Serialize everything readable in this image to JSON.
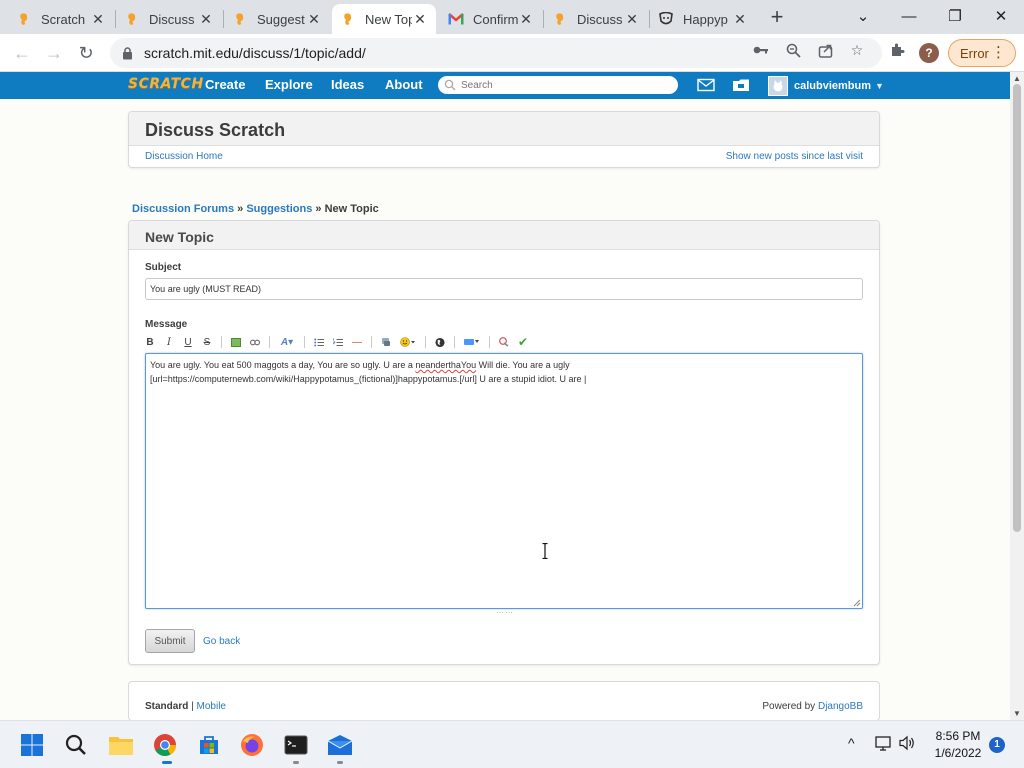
{
  "browser": {
    "tabs": [
      {
        "title": "Scratch",
        "icon": "scratch-favicon",
        "active": false
      },
      {
        "title": "Discuss",
        "icon": "scratch-favicon",
        "active": false
      },
      {
        "title": "Suggest",
        "icon": "scratch-favicon",
        "active": false
      },
      {
        "title": "New Top",
        "icon": "scratch-favicon",
        "active": true
      },
      {
        "title": "Confirm",
        "icon": "gmail-favicon",
        "active": false
      },
      {
        "title": "Discuss",
        "icon": "scratch-favicon",
        "active": false
      },
      {
        "title": "Happyp",
        "icon": "fandom-favicon",
        "active": false
      }
    ],
    "url": "scratch.mit.edu/discuss/1/topic/add/",
    "error_label": "Error",
    "profile_initial": "?",
    "colors": {
      "tabstrip": "#dee1e6",
      "error_bg": "#fde7d1"
    }
  },
  "scratch_nav": {
    "logo_text": "SCRATCH",
    "links": [
      "Create",
      "Explore",
      "Ideas",
      "About"
    ],
    "search_placeholder": "Search",
    "username": "calubviembum",
    "colors": {
      "bar": "#0f7bc0",
      "logo": "#f3b33d"
    }
  },
  "discuss_header": {
    "title": "Discuss Scratch",
    "home_link": "Discussion Home",
    "new_posts_link": "Show new posts since last visit"
  },
  "breadcrumb": {
    "forums": "Discussion Forums",
    "sep": "»",
    "category": "Suggestions",
    "current": "New Topic"
  },
  "new_topic": {
    "heading": "New Topic",
    "subject_label": "Subject",
    "subject_value": "You are ugly (MUST READ)",
    "message_label": "Message",
    "message_part1": "You are ugly. You eat 500 maggots a day, You are so ugly. U are a ",
    "message_misspelled": "neanderthaYou",
    "message_part2": " Will die. You are a ugly\n[url=https://computernewb.com/wiki/Happypotamus_(fictional)]happypotamus.[/url] U are a stupid idiot. U are |",
    "submit_label": "Submit",
    "goback_label": "Go back"
  },
  "footer": {
    "standard": "Standard",
    "pipe": "|",
    "mobile": "Mobile",
    "powered_by": "Powered by",
    "djangobb": "DjangoBB"
  },
  "taskbar": {
    "time": "8:56 PM",
    "date": "1/6/2022",
    "notifications": "1"
  }
}
